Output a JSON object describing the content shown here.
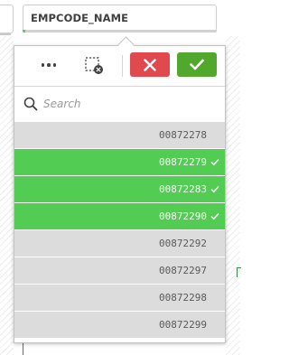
{
  "field": {
    "title": "EMPCODE_NAME"
  },
  "toolbar": {
    "more_icon": "more-horizontal-icon",
    "clear_icon": "clear-selections-icon",
    "cancel_icon": "close-icon",
    "confirm_icon": "checkmark-icon",
    "cancel_color": "#e04a4f",
    "confirm_color": "#52a82c"
  },
  "search": {
    "placeholder": "Search",
    "value": ""
  },
  "colors": {
    "selected": "#52cc52",
    "possible": "#dcdcdc"
  },
  "list": {
    "items": [
      {
        "value": "00872278",
        "selected": false
      },
      {
        "value": "00872279",
        "selected": true
      },
      {
        "value": "00872283",
        "selected": true
      },
      {
        "value": "00872290",
        "selected": true
      },
      {
        "value": "00872292",
        "selected": false
      },
      {
        "value": "00872297",
        "selected": false
      },
      {
        "value": "00872298",
        "selected": false
      },
      {
        "value": "00872299",
        "selected": false
      }
    ]
  }
}
